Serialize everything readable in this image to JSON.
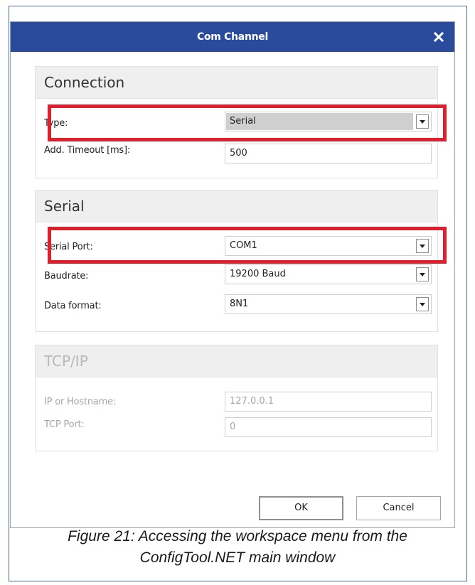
{
  "dialog": {
    "title": "Com Channel"
  },
  "connection": {
    "title": "Connection",
    "type_label": "Type:",
    "type_value": "Serial",
    "timeout_label": "Add. Timeout [ms]:",
    "timeout_value": "500"
  },
  "serial": {
    "title": "Serial",
    "port_label": "Serial Port:",
    "port_value": "COM1",
    "baud_label": "Baudrate:",
    "baud_value": "19200 Baud",
    "format_label": "Data format:",
    "format_value": "8N1"
  },
  "tcpip": {
    "title": "TCP/IP",
    "host_label": "IP or Hostname:",
    "host_value": "127.0.0.1",
    "port_label": "TCP Port:",
    "port_value": "0"
  },
  "buttons": {
    "ok": "OK",
    "cancel": "Cancel"
  },
  "caption": {
    "line1": "Figure 21: Accessing the workspace menu from the",
    "line2": "ConfigTool.NET main window"
  },
  "colors": {
    "titlebar": "#2a4b9b",
    "highlight": "#e11e2c",
    "group_header": "#efefef"
  },
  "icons": {
    "close": "close-icon",
    "dropdown": "chevron-down-icon"
  }
}
